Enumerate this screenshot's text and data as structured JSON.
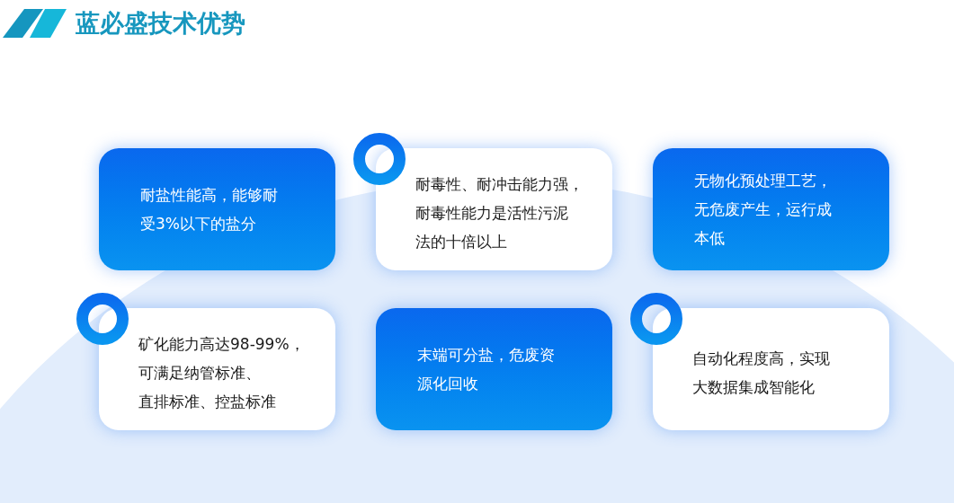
{
  "header": {
    "title": "蓝必盛技术优势"
  },
  "cards": [
    {
      "kind": "filled",
      "lines": [
        "耐盐性能高，能够耐",
        "受3%以下的盐分"
      ]
    },
    {
      "kind": "ring",
      "lines": [
        "耐毒性、耐冲击能力强，",
        "耐毒性能力是活性污泥",
        "法的十倍以上"
      ]
    },
    {
      "kind": "filled",
      "lines": [
        "无物化预处理工艺，",
        "无危废产生，运行成",
        "本低"
      ]
    },
    {
      "kind": "ring",
      "lines": [
        "矿化能力高达98-99%，",
        "可满足纳管标准、",
        "直排标准、控盐标准"
      ]
    },
    {
      "kind": "filled",
      "lines": [
        "末端可分盐，危废资",
        "源化回收"
      ]
    },
    {
      "kind": "ring",
      "lines": [
        "自动化程度高，实现",
        "大数据集成智能化"
      ]
    }
  ]
}
